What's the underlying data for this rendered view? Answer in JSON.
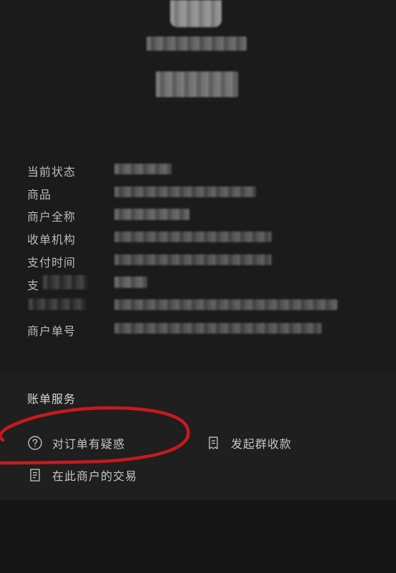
{
  "details": {
    "rows": [
      {
        "label": "当前状态"
      },
      {
        "label": "商品"
      },
      {
        "label": "商户全称"
      },
      {
        "label": "收单机构"
      },
      {
        "label": "支付时间"
      },
      {
        "label": "支"
      },
      {
        "label": ""
      },
      {
        "label": "商户单号"
      }
    ]
  },
  "services": {
    "title": "账单服务",
    "dispute": "对订单有疑惑",
    "group_collect": "发起群收款",
    "merchant_transactions": "在此商户的交易"
  },
  "annotation": {
    "color": "#c8191d"
  },
  "icons": {
    "question": "question-circle-icon",
    "group_collect": "receipt-icon",
    "transactions": "document-list-icon"
  }
}
